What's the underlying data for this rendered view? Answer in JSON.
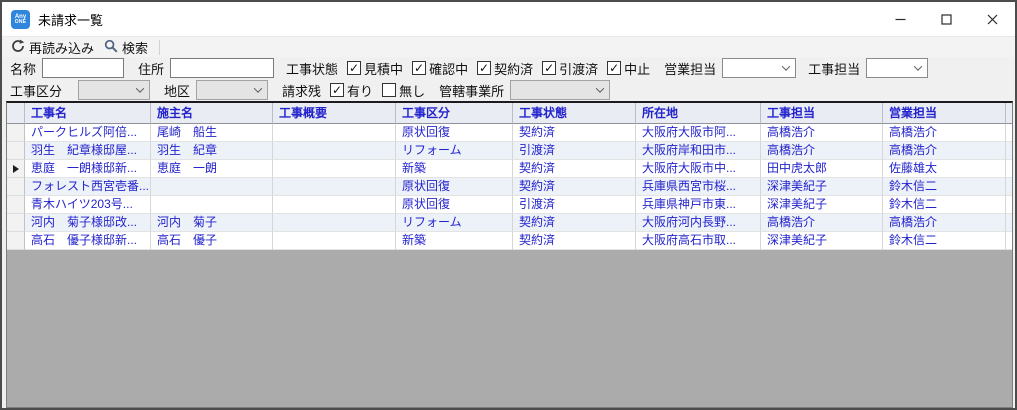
{
  "window": {
    "title": "未請求一覧",
    "app_icon_text_top": "Any",
    "app_icon_text_bottom": "ONE"
  },
  "toolbar": {
    "reload_label": "再読み込み",
    "search_label": "検索"
  },
  "filters": {
    "name_label": "名称",
    "name_value": "",
    "address_label": "住所",
    "address_value": "",
    "status_label": "工事状態",
    "status_options": [
      {
        "label": "見積中",
        "checked": true
      },
      {
        "label": "確認中",
        "checked": true
      },
      {
        "label": "契約済",
        "checked": true
      },
      {
        "label": "引渡済",
        "checked": true
      },
      {
        "label": "中止",
        "checked": true
      }
    ],
    "sales_label": "営業担当",
    "sales_value": "",
    "construction_label": "工事担当",
    "construction_value": "",
    "category_label": "工事区分",
    "category_value": "",
    "district_label": "地区",
    "district_value": "",
    "billing_label": "請求残",
    "billing_options": [
      {
        "label": "有り",
        "checked": true
      },
      {
        "label": "無し",
        "checked": false
      }
    ],
    "office_label": "管轄事業所",
    "office_value": ""
  },
  "table": {
    "columns": [
      "工事名",
      "施主名",
      "工事概要",
      "工事区分",
      "工事状態",
      "所在地",
      "工事担当",
      "営業担当"
    ],
    "rows": [
      {
        "current": false,
        "cells": [
          "パークヒルズ阿倍...",
          "尾崎　船生",
          "",
          "原状回復",
          "契約済",
          "大阪府大阪市阿...",
          "高橋浩介",
          "高橋浩介"
        ]
      },
      {
        "current": false,
        "cells": [
          "羽生　紀章様邸屋...",
          "羽生　紀章",
          "",
          "リフォーム",
          "引渡済",
          "大阪府岸和田市...",
          "高橋浩介",
          "高橋浩介"
        ]
      },
      {
        "current": true,
        "cells": [
          "恵庭　一朗様邸新...",
          "恵庭　一朗",
          "",
          "新築",
          "契約済",
          "大阪府大阪市中...",
          "田中虎太郎",
          "佐藤雄太"
        ]
      },
      {
        "current": false,
        "cells": [
          "フォレスト西宮壱番...",
          "",
          "",
          "原状回復",
          "契約済",
          "兵庫県西宮市桜...",
          "深津美紀子",
          "鈴木信二"
        ]
      },
      {
        "current": false,
        "cells": [
          "青木ハイツ203号...",
          "",
          "",
          "原状回復",
          "引渡済",
          "兵庫県神戸市東...",
          "深津美紀子",
          "鈴木信二"
        ]
      },
      {
        "current": false,
        "cells": [
          "河内　菊子様邸改...",
          "河内　菊子",
          "",
          "リフォーム",
          "契約済",
          "大阪府河内長野...",
          "高橋浩介",
          "高橋浩介"
        ]
      },
      {
        "current": false,
        "cells": [
          "高石　優子様邸新...",
          "高石　優子",
          "",
          "新築",
          "契約済",
          "大阪府高石市取...",
          "深津美紀子",
          "鈴木信二"
        ]
      }
    ]
  },
  "icons": {
    "app": "anyone-logo",
    "reload": "circular-arrow",
    "search": "magnifier",
    "minimize": "minus-line",
    "maximize": "square-outline",
    "close": "x-cross",
    "combo": "chevron-down",
    "current_row": "right-triangle",
    "checkbox_check": "✓"
  },
  "colors": {
    "accent_text": "#2323cd",
    "header_bg": "#e9ecf3",
    "alt_row_bg": "#edf1f8",
    "empty_area": "#ababab",
    "app_icon_bg": "#2f86dd",
    "titlebar_bg": "#ffffff"
  }
}
